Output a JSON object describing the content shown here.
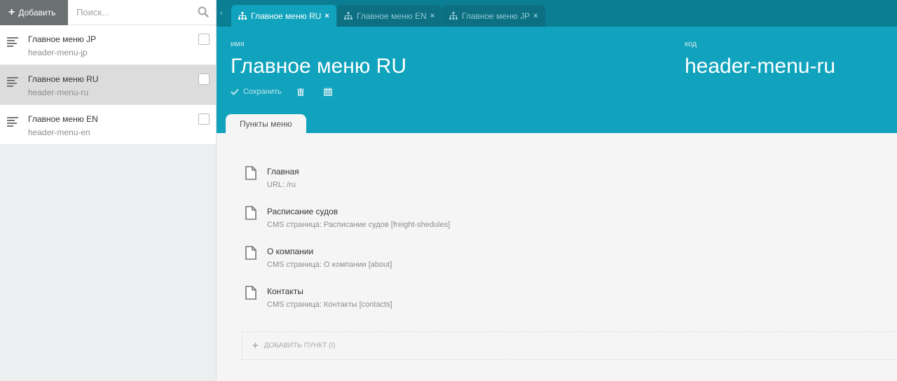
{
  "sidebar": {
    "add_label": "Добавить",
    "search_placeholder": "Поиск...",
    "items": [
      {
        "title": "Главное меню JP",
        "code": "header-menu-jp"
      },
      {
        "title": "Главное меню RU",
        "code": "header-menu-ru"
      },
      {
        "title": "Главное меню EN",
        "code": "header-menu-en"
      }
    ]
  },
  "tabs": [
    {
      "label": "Главное меню RU"
    },
    {
      "label": "Главное меню EN"
    },
    {
      "label": "Главное меню JP"
    }
  ],
  "header": {
    "name_label": "ИМЯ",
    "name_value": "Главное меню RU",
    "code_label": "КОД",
    "code_value": "header-menu-ru",
    "save_label": "Сохранить",
    "inner_tab_label": "Пункты меню"
  },
  "menu_items": [
    {
      "title": "Главная",
      "subtitle": "URL: /ru"
    },
    {
      "title": "Расписание судов",
      "subtitle": "CMS страница: Расписание судов [freight-shedules]"
    },
    {
      "title": "О компании",
      "subtitle": "CMS страница: О компании [about]"
    },
    {
      "title": "Контакты",
      "subtitle": "CMS страница: Контакты [contacts]"
    }
  ],
  "add_item_label": "ДОБАВИТЬ ПУНКТ (I)",
  "colors": {
    "accent": "#11a3bd",
    "tabbar": "#0b7e93",
    "active_sidebar_item": "#dcdcdc"
  },
  "icons": [
    "plus-icon",
    "search-icon",
    "list-icon",
    "sitemap-icon",
    "close-icon",
    "check-icon",
    "trash-icon",
    "calendar-icon",
    "document-icon"
  ]
}
